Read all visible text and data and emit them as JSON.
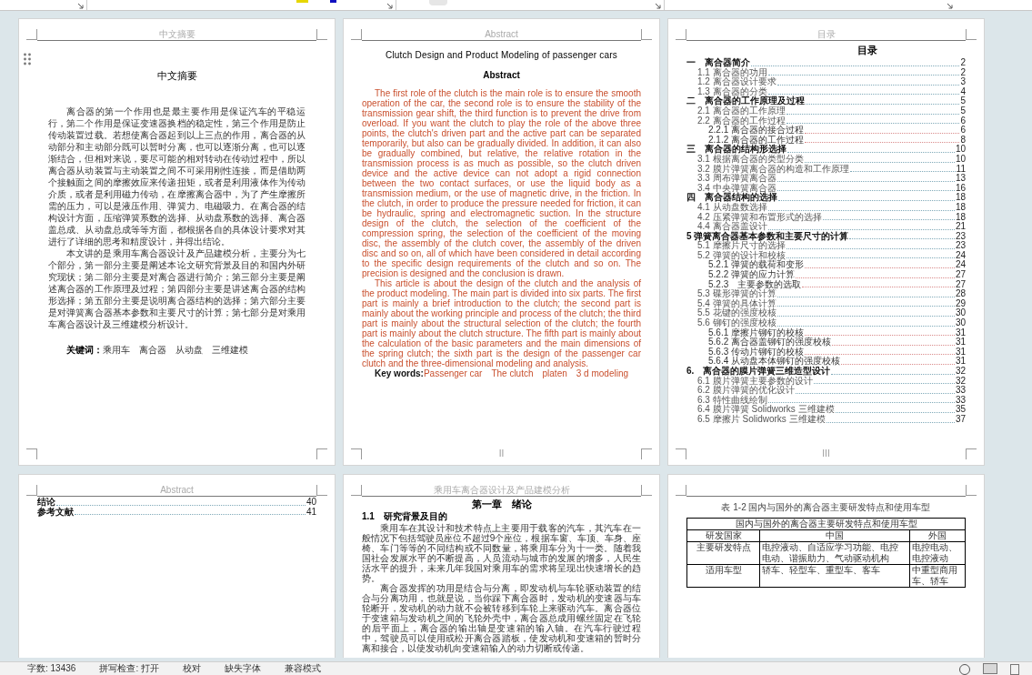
{
  "abstract_cn_page": {
    "header": "中文摘要",
    "title": "中文摘要",
    "paragraphs": [
      "离合器的第一个作用也是最主要作用是保证汽车的平稳运行，第二个作用是保证变速器换档的稳定性，第三个作用是防止传动装置过载。若想使离合器起到以上三点的作用，离合器的从动部分和主动部分既可以暂时分离，也可以逐渐分离，也可以逐渐结合，但相对来说，要尽可能的相对转动在传动过程中，所以离合器从动装置与主动装置之间不可采用刚性连接，而是借助两个接触面之间的摩擦效应来传递扭矩，或者是利用液体作为传动介质，或者是利用磁力传动，在摩擦离合器中，为了产生摩擦所需的压力，可以是液压作用、弹簧力、电磁吸力。在离合器的结构设计方面，压缩弹簧系数的选择、从动盘系数的选择、离合器盖总成、从动盘总成等等方面，都根据各自的具体设计要求对其进行了详细的思考和精度设计，并得出结论。",
      "本文讲的是乘用车离合器设计及产品建模分析，主要分为七个部分，第一部分主要是阐述本论文研究背景及目的和国内外研究现状；第二部分主要是对离合器进行简介；第三部分主要是阐述离合器的工作原理及过程；第四部分主要是讲述离合器的结构形选择；第五部分主要是说明离合器结构的选择；第六部分主要是对弹簧离合器基本参数和主要尺寸的计算；第七部分是对乘用车离合器设计及三维建模分析设计。"
    ],
    "keywords_label": "关键词：",
    "keywords": "乘用车　离合器　从动盘　三维建模"
  },
  "abstract_en_page": {
    "header": "Abstract",
    "title": "Clutch Design and Product Modeling of passenger cars",
    "heading": "Abstract",
    "paragraphs": [
      "The first role of the clutch is the main role is to ensure the smooth operation of the car, the second role is to ensure the stability of the transmission gear shift, the third function is to prevent the drive from overload. If you want the clutch to play the role of the above three points, the clutch's driven part and the active part can be separated temporarily, but also can be gradually divided. In addition, it can also be gradually combined, but relative, the relative rotation in the transmission process is as much as possible, so the clutch driven device and the active device can not adopt a rigid connection between the two contact surfaces, or use the liquid body as a transmission medium, or the use of magnetic drive, in the friction. In the clutch, in order to produce the pressure needed for friction, it can be hydraulic, spring and electromagnetic suction. In the structure design of the clutch, the selection of the coefficient of the compression spring, the selection of the coefficient of the moving disc, the assembly of the clutch cover, the assembly of the driven disc and so on, all of which have been considered in detail according to the specific design requirements of the clutch and so on. The precision is designed and the conclusion is drawn.",
      "This article is about the design of the clutch and the analysis of the product modeling. The main part is divided into six parts. The first part is mainly a brief introduction to the clutch; the second part is mainly about the working principle and process of the clutch; the third part is mainly about the structural selection of the clutch; the fourth part is mainly about the clutch structure. The fifth part is mainly about the calculation of the basic parameters and the main dimensions of the spring clutch; the sixth part is the design of the passenger car clutch and the three-dimensional modeling and analysis."
    ],
    "keywords_label": "Key words:",
    "keywords": "Passenger car　The clutch　platen　3 d modeling",
    "footer": "II"
  },
  "toc_page": {
    "header": "目录",
    "title": "目录",
    "entries": [
      {
        "label": "一　离合器简介",
        "page": "2",
        "children": [
          {
            "label": "1.1 离合器的功用",
            "page": "2"
          },
          {
            "label": "1.2 离合器设计要求",
            "page": "3"
          },
          {
            "label": "1.3 离合器的分类",
            "page": "4"
          }
        ]
      },
      {
        "label": "二　离合器的工作原理及过程",
        "page": "5",
        "children": [
          {
            "label": "2.1 离合器的工作原理",
            "page": "5"
          },
          {
            "label": "2.2 离合器的工作过程",
            "page": "6",
            "children": [
              {
                "label": "2.2.1 离合器的接合过程",
                "page": "6"
              },
              {
                "label": "2.1.2 离合器的工作过程",
                "page": "8"
              }
            ]
          }
        ]
      },
      {
        "label": "三　离合器的结构形选择",
        "page": "10",
        "children": [
          {
            "label": "3.1 根据离合器的类型分类",
            "page": "10"
          },
          {
            "label": "3.2 膜片弹簧离合器的构造和工作原理",
            "page": "11"
          },
          {
            "label": "3.3 周布弹簧离合器",
            "page": "13"
          },
          {
            "label": "3.4 中央弹簧离合器",
            "page": "16"
          }
        ]
      },
      {
        "label": "四　离合器结构的选择",
        "page": "18",
        "children": [
          {
            "label": "4.1 从动盘数选择",
            "page": "18"
          },
          {
            "label": "4.2 压紧弹簧和布置形式的选择",
            "page": "18"
          },
          {
            "label": "4.4 离合器盖设计",
            "page": "21"
          }
        ]
      },
      {
        "label": "5 弹簧离合器基本参数和主要尺寸的计算",
        "page": "23",
        "children": [
          {
            "label": "5.1 摩擦片尺寸的选择",
            "page": "23"
          },
          {
            "label": "5.2 弹簧的设计和校核",
            "page": "24",
            "children": [
              {
                "label": "5.2.1 弹簧的载荷和变形",
                "page": "24"
              },
              {
                "label": "5.2.2 弹簧的应力计算",
                "page": "27"
              },
              {
                "label": "5.2.3　主要参数的选取",
                "page": "27"
              }
            ]
          },
          {
            "label": "5.3 碟形弹簧的计算",
            "page": "28"
          },
          {
            "label": "5.4 弹簧的具体计算",
            "page": "29"
          },
          {
            "label": "5.5 花键的强度校核",
            "page": "30"
          },
          {
            "label": "5.6 铆钉的强度校核",
            "page": "30",
            "children": [
              {
                "label": "5.6.1 摩擦片铆钉的校核",
                "page": "31"
              },
              {
                "label": "5.6.2 离合器盖铆钉的强度校核",
                "page": "31"
              },
              {
                "label": "5.6.3 传动片铆钉的校核",
                "page": "31"
              },
              {
                "label": "5.6.4 从动盘本体铆钉的强度校核",
                "page": "31"
              }
            ]
          }
        ]
      },
      {
        "label": "6.　离合器的膜片弹簧三维造型设计",
        "page": "32",
        "children": [
          {
            "label": "6.1 膜片弹簧主要参数的设计",
            "page": "32"
          },
          {
            "label": "6.2 膜片弹簧的优化设计",
            "page": "33"
          },
          {
            "label": "6.3 特性曲线绘制",
            "page": "33"
          },
          {
            "label": "6.4 膜片弹簧 Solidworks 三维建模",
            "page": "35"
          },
          {
            "label": "6.5 摩擦片 Solidworks 三维建模",
            "page": "37"
          }
        ]
      }
    ],
    "footer": "III"
  },
  "toc_end_page": {
    "header": "Abstract",
    "entries": [
      {
        "label": "结论",
        "page": "40"
      },
      {
        "label": "参考文献",
        "page": "41"
      }
    ]
  },
  "chapter_page": {
    "header": "乘用车离合器设计及产品建模分析",
    "title": "第一章　绪论",
    "section": "1.1　研究背景及目的",
    "paragraphs": [
      "乘用车在其设计和技术特点上主要用于载客的汽车，其汽车在一般情况下包括驾驶员座位不超过9个座位，根据车窗、车顶、车身、座椅、车门等等的不同结构或不同数量，将乘用车分为十一类。随着我国社会发展水平的不断提高，人员流动与城市的发展的增多，人民生活水平的提升，未来几年我国对乘用车的需求将呈现出快速增长的趋势。",
      "离合器发挥的功用是结合与分离，即发动机与车轮驱动装置的结合与分离功用，也就是说，当你踩下离合器时，发动机的变速器与车轮断开，发动机的动力就不会被转移到车轮上来驱动汽车。离合器位于变速箱与发动机之间的飞轮外壳中，离合器总成用螺丝固定在飞轮的后平面上，离合器的输出轴是变速箱的输入轴。在汽车行驶过程中，驾驶员可以使用或松开离合器踏板，使发动机和变速箱的暂时分离和接合，以使发动机向变速箱输入的动力切断或传递。"
    ]
  },
  "table_page": {
    "caption": "表 1-2 国内与国外的离合器主要研发特点和使用车型",
    "table_title": "国内与国外的离合器主要研发特点和使用车型",
    "columns": [
      "研发国家",
      "中国",
      "外国"
    ],
    "rows": [
      [
        "主要研发特点",
        "电控液动、自适应学习功能、电控电动、谐振助力、气动驱动机构",
        "电控电动、电控液动"
      ],
      [
        "适用车型",
        "轿车、轻型车、重型车、客车",
        "中重型商用车、轿车"
      ]
    ]
  },
  "status_bar": {
    "items": [
      "字数: 13436",
      "拼写检查: 打开",
      "校对",
      "缺失字体",
      "兼容模式"
    ]
  }
}
